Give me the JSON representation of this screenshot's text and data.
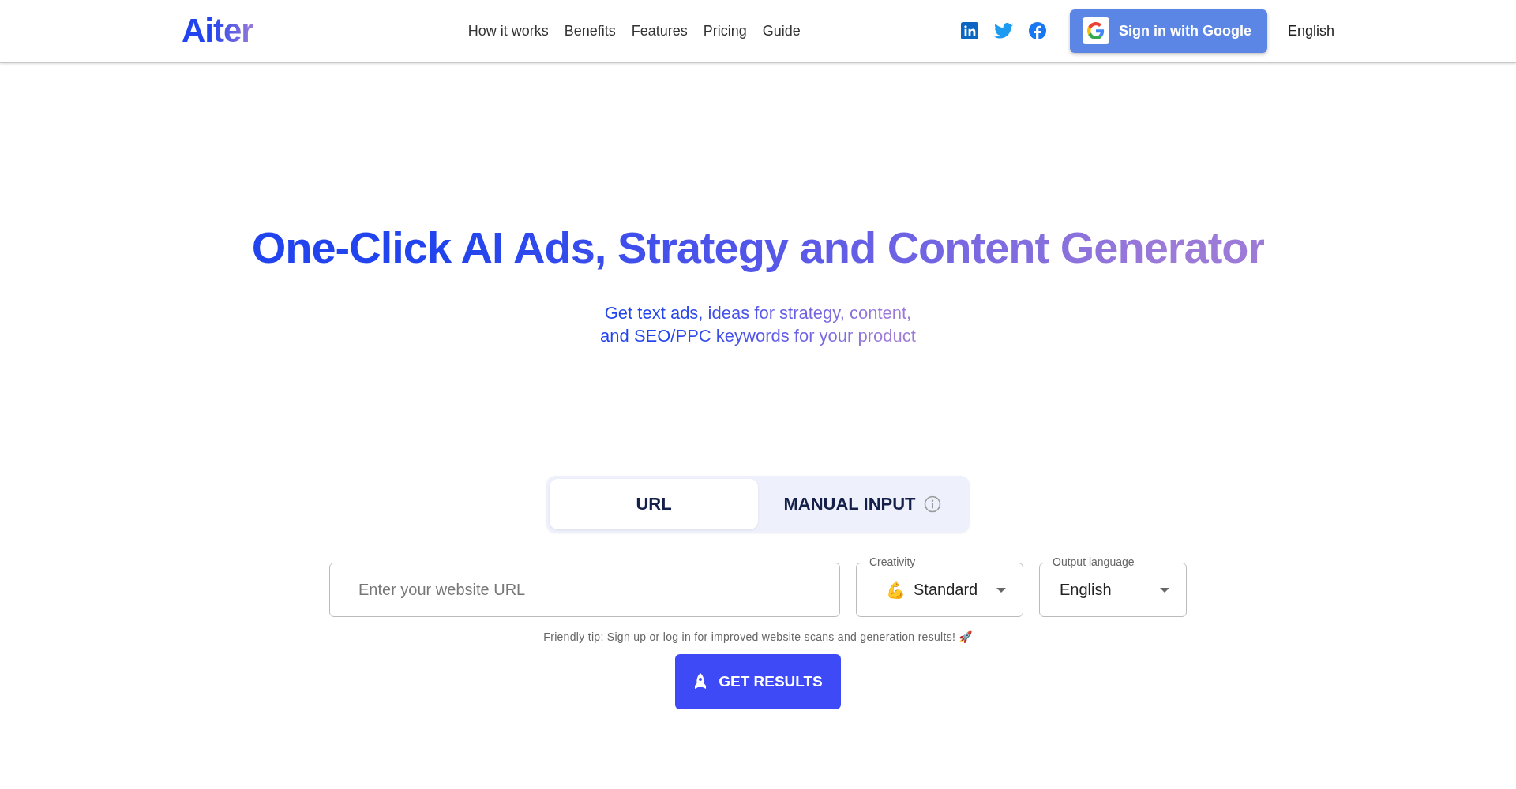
{
  "header": {
    "logo": "Aiter",
    "nav": [
      {
        "label": "How it works"
      },
      {
        "label": "Benefits"
      },
      {
        "label": "Features"
      },
      {
        "label": "Pricing"
      },
      {
        "label": "Guide"
      }
    ],
    "social": [
      {
        "kind": "linkedin"
      },
      {
        "kind": "twitter"
      },
      {
        "kind": "facebook"
      }
    ],
    "sign_in": "Sign in with Google",
    "language": "English"
  },
  "hero": {
    "title": "One-Click AI Ads, Strategy and Content Generator",
    "subtitle_lines": [
      "Get text ads, ideas for strategy, content,",
      "and SEO/PPC keywords for your product"
    ]
  },
  "tabs": [
    {
      "label": "URL",
      "selected": true,
      "info": false
    },
    {
      "label": "MANUAL INPUT",
      "selected": false,
      "info": true
    }
  ],
  "url_field": {
    "placeholder": "Enter your website URL"
  },
  "creativity": {
    "label": "Creativity",
    "emoji": "💪",
    "value": "Standard"
  },
  "output_language": {
    "label": "Output language",
    "value": "English"
  },
  "tip": "Friendly tip: Sign up or log in for improved website scans and generation results! 🚀",
  "submit": "GET RESULTS"
}
